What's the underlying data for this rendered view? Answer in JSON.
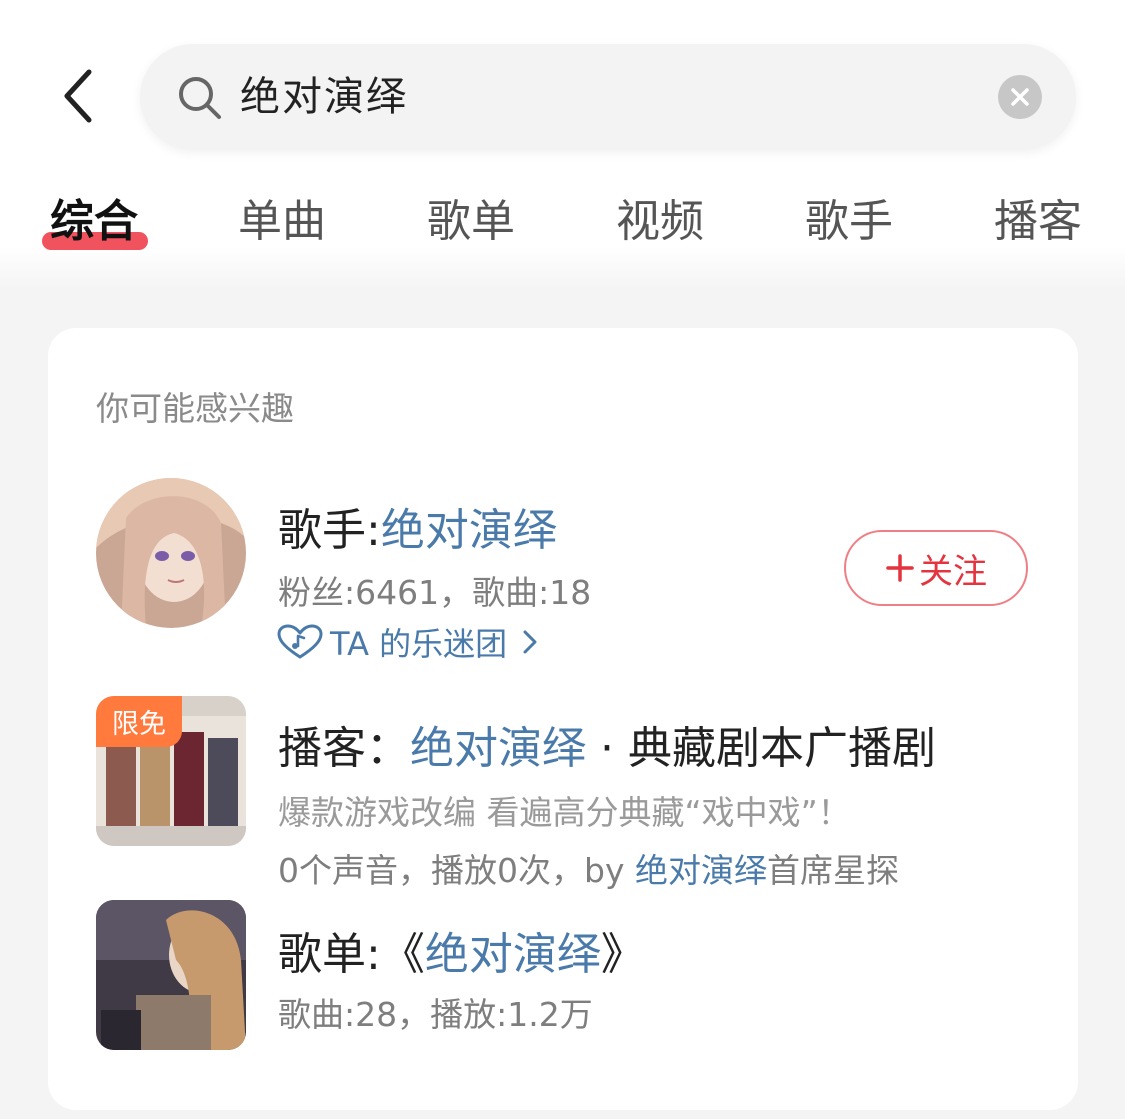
{
  "search": {
    "query": "绝对演绎"
  },
  "tabs": [
    {
      "label": "综合",
      "active": true
    },
    {
      "label": "单曲"
    },
    {
      "label": "歌单"
    },
    {
      "label": "视频"
    },
    {
      "label": "歌手"
    },
    {
      "label": "播客"
    }
  ],
  "section": {
    "title": "你可能感兴趣"
  },
  "results": {
    "artist": {
      "prefix": "歌手:",
      "name": "绝对演绎",
      "stats": "粉丝:6461，歌曲:18",
      "fanclub": "TA 的乐迷团",
      "follow_label": "关注"
    },
    "podcast": {
      "prefix": "播客：",
      "name": "绝对演绎",
      "suffix": " · 典藏剧本广播剧",
      "badge": "限免",
      "desc": "爆款游戏改编 看遍高分典藏“戏中戏”！",
      "meta_prefix": "0个声音，播放0次，by ",
      "meta_author": "绝对演绎",
      "meta_suffix": "首席星探"
    },
    "playlist": {
      "prefix": "歌单:《",
      "name": "绝对演绎",
      "suffix": "》",
      "stats": "歌曲:28，播放:1.2万"
    }
  },
  "colors": {
    "accent": "#f0404d",
    "link": "#4a7aaa",
    "badge": "#ff7a3c"
  }
}
